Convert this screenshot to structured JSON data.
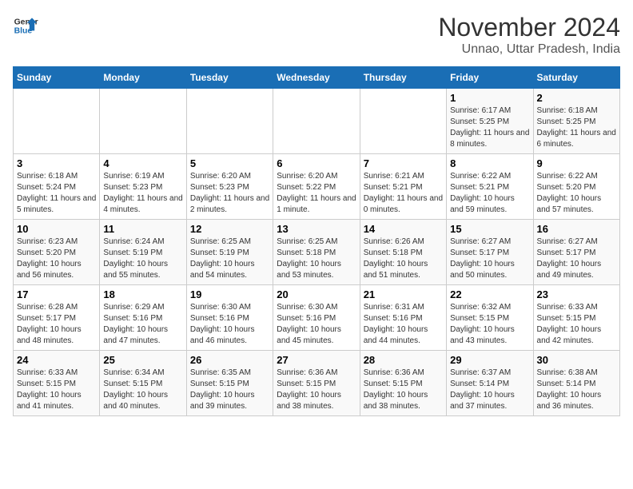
{
  "header": {
    "logo_line1": "General",
    "logo_line2": "Blue",
    "month": "November 2024",
    "location": "Unnao, Uttar Pradesh, India"
  },
  "weekdays": [
    "Sunday",
    "Monday",
    "Tuesday",
    "Wednesday",
    "Thursday",
    "Friday",
    "Saturday"
  ],
  "weeks": [
    [
      {
        "day": "",
        "info": ""
      },
      {
        "day": "",
        "info": ""
      },
      {
        "day": "",
        "info": ""
      },
      {
        "day": "",
        "info": ""
      },
      {
        "day": "",
        "info": ""
      },
      {
        "day": "1",
        "info": "Sunrise: 6:17 AM\nSunset: 5:25 PM\nDaylight: 11 hours and 8 minutes."
      },
      {
        "day": "2",
        "info": "Sunrise: 6:18 AM\nSunset: 5:25 PM\nDaylight: 11 hours and 6 minutes."
      }
    ],
    [
      {
        "day": "3",
        "info": "Sunrise: 6:18 AM\nSunset: 5:24 PM\nDaylight: 11 hours and 5 minutes."
      },
      {
        "day": "4",
        "info": "Sunrise: 6:19 AM\nSunset: 5:23 PM\nDaylight: 11 hours and 4 minutes."
      },
      {
        "day": "5",
        "info": "Sunrise: 6:20 AM\nSunset: 5:23 PM\nDaylight: 11 hours and 2 minutes."
      },
      {
        "day": "6",
        "info": "Sunrise: 6:20 AM\nSunset: 5:22 PM\nDaylight: 11 hours and 1 minute."
      },
      {
        "day": "7",
        "info": "Sunrise: 6:21 AM\nSunset: 5:21 PM\nDaylight: 11 hours and 0 minutes."
      },
      {
        "day": "8",
        "info": "Sunrise: 6:22 AM\nSunset: 5:21 PM\nDaylight: 10 hours and 59 minutes."
      },
      {
        "day": "9",
        "info": "Sunrise: 6:22 AM\nSunset: 5:20 PM\nDaylight: 10 hours and 57 minutes."
      }
    ],
    [
      {
        "day": "10",
        "info": "Sunrise: 6:23 AM\nSunset: 5:20 PM\nDaylight: 10 hours and 56 minutes."
      },
      {
        "day": "11",
        "info": "Sunrise: 6:24 AM\nSunset: 5:19 PM\nDaylight: 10 hours and 55 minutes."
      },
      {
        "day": "12",
        "info": "Sunrise: 6:25 AM\nSunset: 5:19 PM\nDaylight: 10 hours and 54 minutes."
      },
      {
        "day": "13",
        "info": "Sunrise: 6:25 AM\nSunset: 5:18 PM\nDaylight: 10 hours and 53 minutes."
      },
      {
        "day": "14",
        "info": "Sunrise: 6:26 AM\nSunset: 5:18 PM\nDaylight: 10 hours and 51 minutes."
      },
      {
        "day": "15",
        "info": "Sunrise: 6:27 AM\nSunset: 5:17 PM\nDaylight: 10 hours and 50 minutes."
      },
      {
        "day": "16",
        "info": "Sunrise: 6:27 AM\nSunset: 5:17 PM\nDaylight: 10 hours and 49 minutes."
      }
    ],
    [
      {
        "day": "17",
        "info": "Sunrise: 6:28 AM\nSunset: 5:17 PM\nDaylight: 10 hours and 48 minutes."
      },
      {
        "day": "18",
        "info": "Sunrise: 6:29 AM\nSunset: 5:16 PM\nDaylight: 10 hours and 47 minutes."
      },
      {
        "day": "19",
        "info": "Sunrise: 6:30 AM\nSunset: 5:16 PM\nDaylight: 10 hours and 46 minutes."
      },
      {
        "day": "20",
        "info": "Sunrise: 6:30 AM\nSunset: 5:16 PM\nDaylight: 10 hours and 45 minutes."
      },
      {
        "day": "21",
        "info": "Sunrise: 6:31 AM\nSunset: 5:16 PM\nDaylight: 10 hours and 44 minutes."
      },
      {
        "day": "22",
        "info": "Sunrise: 6:32 AM\nSunset: 5:15 PM\nDaylight: 10 hours and 43 minutes."
      },
      {
        "day": "23",
        "info": "Sunrise: 6:33 AM\nSunset: 5:15 PM\nDaylight: 10 hours and 42 minutes."
      }
    ],
    [
      {
        "day": "24",
        "info": "Sunrise: 6:33 AM\nSunset: 5:15 PM\nDaylight: 10 hours and 41 minutes."
      },
      {
        "day": "25",
        "info": "Sunrise: 6:34 AM\nSunset: 5:15 PM\nDaylight: 10 hours and 40 minutes."
      },
      {
        "day": "26",
        "info": "Sunrise: 6:35 AM\nSunset: 5:15 PM\nDaylight: 10 hours and 39 minutes."
      },
      {
        "day": "27",
        "info": "Sunrise: 6:36 AM\nSunset: 5:15 PM\nDaylight: 10 hours and 38 minutes."
      },
      {
        "day": "28",
        "info": "Sunrise: 6:36 AM\nSunset: 5:15 PM\nDaylight: 10 hours and 38 minutes."
      },
      {
        "day": "29",
        "info": "Sunrise: 6:37 AM\nSunset: 5:14 PM\nDaylight: 10 hours and 37 minutes."
      },
      {
        "day": "30",
        "info": "Sunrise: 6:38 AM\nSunset: 5:14 PM\nDaylight: 10 hours and 36 minutes."
      }
    ]
  ]
}
